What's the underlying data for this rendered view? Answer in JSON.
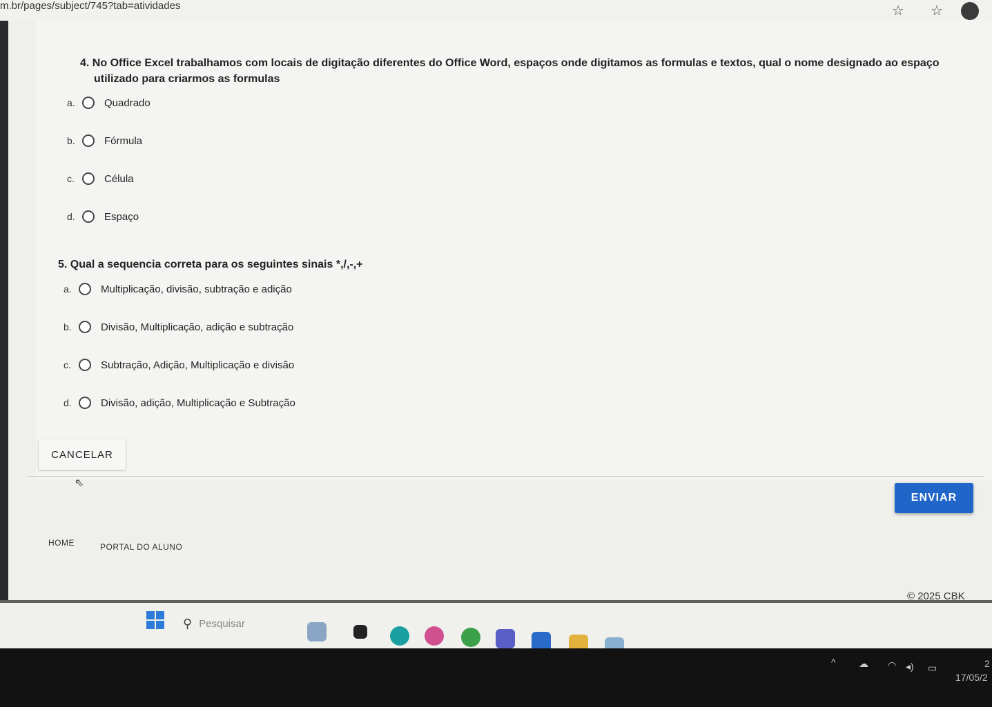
{
  "browser": {
    "url": "m.br/pages/subject/745?tab=atividades"
  },
  "questions": [
    {
      "text_line1": "4. No Office Excel trabalhamos com locais de digitação diferentes do Office Word, espaços onde digitamos as formulas e textos, qual o nome designado ao espaço",
      "text_line2": "utilizado para criarmos as formulas",
      "options": [
        {
          "letter": "a.",
          "label": "Quadrado"
        },
        {
          "letter": "b.",
          "label": "Fórmula"
        },
        {
          "letter": "c.",
          "label": "Célula"
        },
        {
          "letter": "d.",
          "label": "Espaço"
        }
      ]
    },
    {
      "text_line1": "5. Qual a sequencia correta para os seguintes sinais *,/,-,+",
      "options": [
        {
          "letter": "a.",
          "label": "Multiplicação, divisão, subtração e adição"
        },
        {
          "letter": "b.",
          "label": "Divisão, Multiplicação, adição e subtração"
        },
        {
          "letter": "c.",
          "label": "Subtração, Adição, Multiplicação e divisão"
        },
        {
          "letter": "d.",
          "label": "Divisão, adição, Multiplicação e Subtração"
        }
      ]
    }
  ],
  "actions": {
    "cancel_label": "CANCELAR",
    "send_label": "ENVIAR"
  },
  "footer": {
    "nav": [
      "HOME",
      "PORTAL DO ALUNO"
    ],
    "copyright": "© 2025 CBK"
  },
  "taskbar": {
    "search_placeholder": "Pesquisar",
    "date": "17/05/2",
    "time_fragment": "2"
  },
  "colors": {
    "send_button": "#1f66c8",
    "background": "#efefec"
  }
}
